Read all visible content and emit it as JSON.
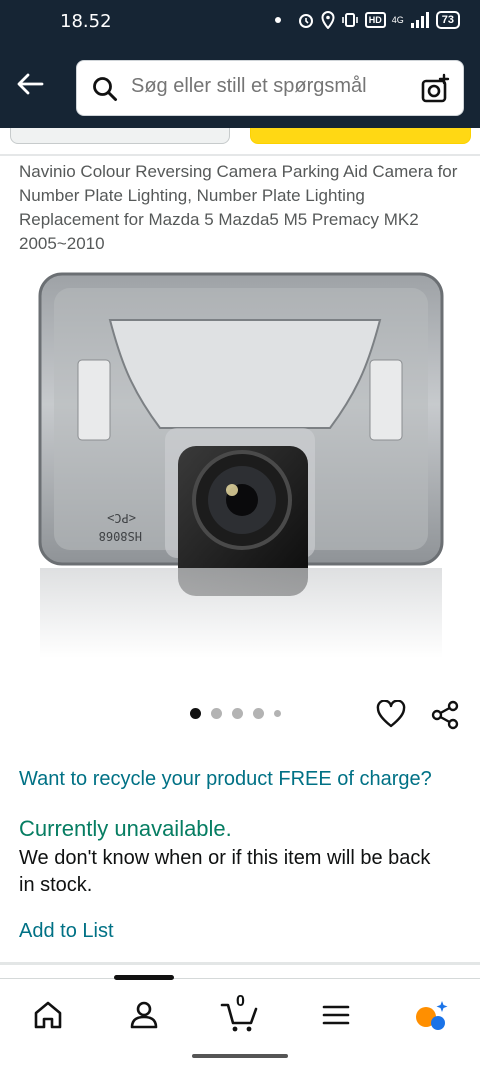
{
  "status_bar": {
    "time": "18.52",
    "network": "4G",
    "hd": "HD",
    "battery": "73"
  },
  "search": {
    "placeholder": "Søg eller still et spørgsmål"
  },
  "product": {
    "title": "Navinio Colour Reversing Camera Parking Aid Camera for Number Plate Lighting, Number Plate Lighting Replacement for Mazda 5 Mazda5 M5 Premacy MK2 2005~2010",
    "image_icon": "reversing-camera-photo",
    "image_count": 5,
    "active_image": 1
  },
  "links": {
    "recycle": "Want to recycle your product FREE of charge?",
    "add_to_list": "Add to List"
  },
  "availability": {
    "status": "Currently unavailable.",
    "detail": "We don't know when or if this item will be back in stock."
  },
  "bottom_nav": {
    "cart_count": "0",
    "items": [
      "home-icon",
      "account-icon",
      "cart-icon",
      "menu-icon",
      "rufus-icon"
    ]
  },
  "colors": {
    "header": "#162534",
    "link": "#007185",
    "unavailable": "#067d62",
    "buy_button": "#ffd814"
  }
}
